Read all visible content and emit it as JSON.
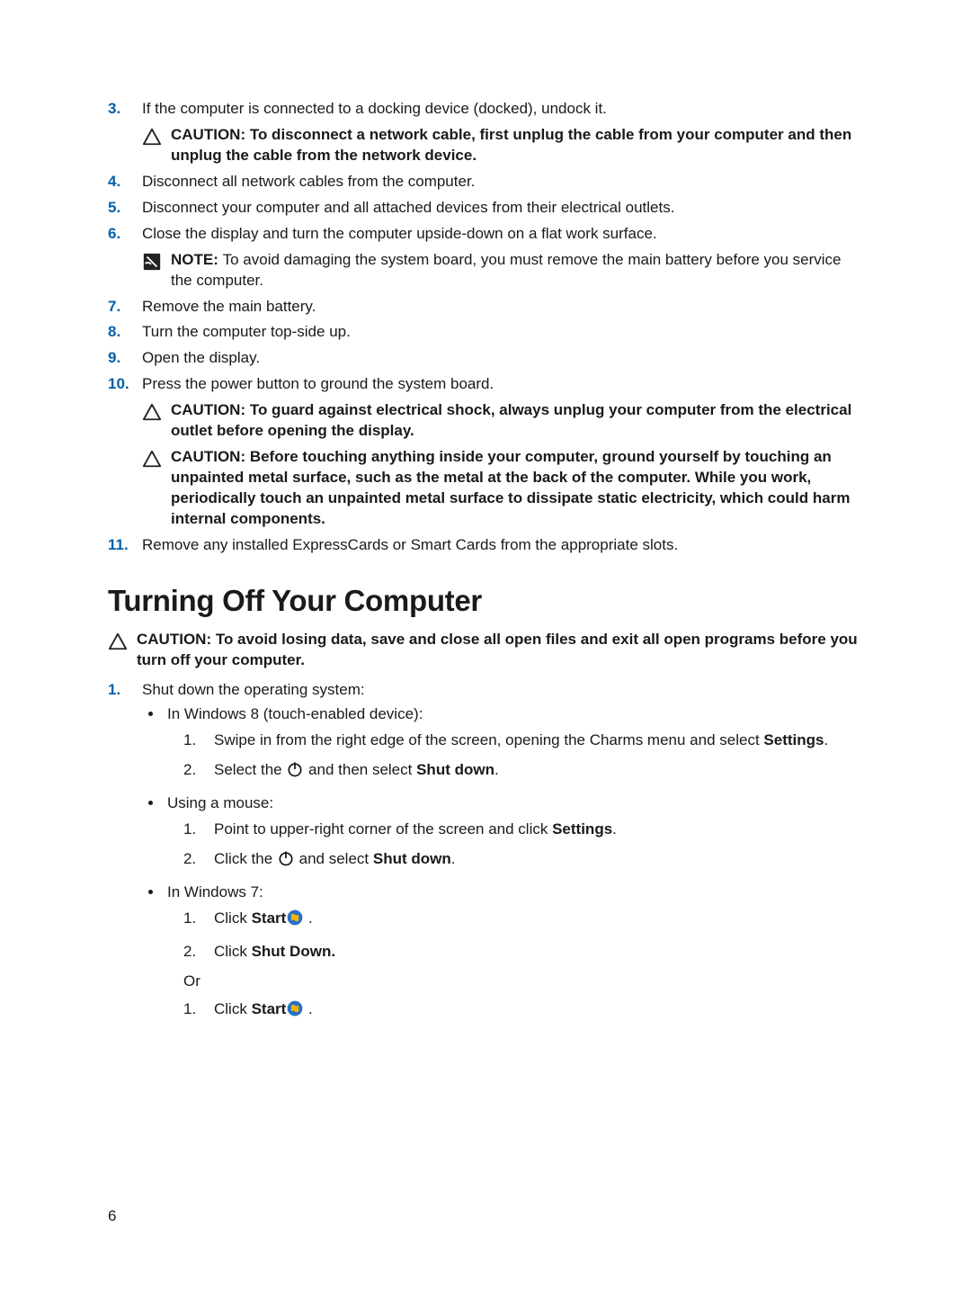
{
  "steps_a": [
    {
      "n": "3.",
      "text": "If the computer is connected to a docking device (docked), undock it."
    },
    {
      "n": "4.",
      "text": "Disconnect all network cables from the computer."
    },
    {
      "n": "5.",
      "text": "Disconnect your computer and all attached devices from their electrical outlets."
    },
    {
      "n": "6.",
      "text": "Close the display and turn the computer upside-down on a flat work surface."
    },
    {
      "n": "7.",
      "text": "Remove the main battery."
    },
    {
      "n": "8.",
      "text": "Turn the computer top-side up."
    },
    {
      "n": "9.",
      "text": "Open the display."
    },
    {
      "n": "10.",
      "text": "Press the power button to ground the system board."
    },
    {
      "n": "11.",
      "text": "Remove any installed ExpressCards or Smart Cards from the appropriate slots."
    }
  ],
  "caution1": {
    "label": "CAUTION: ",
    "text": "To disconnect a network cable, first unplug the cable from your computer and then unplug the cable from the network device."
  },
  "note1": {
    "label": "NOTE: ",
    "text": "To avoid damaging the system board, you must remove the main battery before you service the computer."
  },
  "caution2": {
    "label": "CAUTION: ",
    "text": "To guard against electrical shock, always unplug your computer from the electrical outlet before opening the display."
  },
  "caution3": {
    "label": "CAUTION: ",
    "text": "Before touching anything inside your computer, ground yourself by touching an unpainted metal surface, such as the metal at the back of the computer. While you work, periodically touch an unpainted metal surface to dissipate static electricity, which could harm internal components."
  },
  "section_title": "Turning Off Your Computer",
  "caution4": {
    "label": "CAUTION: ",
    "text": "To avoid losing data, save and close all open files and exit all open programs before you turn off your computer."
  },
  "turnoff": {
    "step1_n": "1.",
    "step1_text": "Shut down the operating system:",
    "win8_label": "In Windows 8 (touch-enabled device):",
    "win8_s1_n": "1.",
    "win8_s1_p1": "Swipe in from the right edge of the screen, opening the Charms menu and select ",
    "win8_s1_b": "Settings",
    "win8_s1_p2": ".",
    "win8_s2_n": "2.",
    "win8_s2_p1": "Select the ",
    "win8_s2_p2": " and then select ",
    "win8_s2_b": "Shut down",
    "win8_s2_p3": ".",
    "mouse_label": "Using a mouse:",
    "mouse_s1_n": "1.",
    "mouse_s1_p1": "Point to upper-right corner of the screen and click ",
    "mouse_s1_b": "Settings",
    "mouse_s1_p2": ".",
    "mouse_s2_n": "2.",
    "mouse_s2_p1": "Click the ",
    "mouse_s2_p2": " and select ",
    "mouse_s2_b": "Shut down",
    "mouse_s2_p3": ".",
    "win7_label": "In Windows 7:",
    "win7_s1_n": "1.",
    "win7_s1_p1": "Click ",
    "win7_s1_b": "Start",
    "win7_s1_p2": " .",
    "win7_s2_n": "2.",
    "win7_s2_p1": "Click ",
    "win7_s2_b": "Shut Down.",
    "or": "Or",
    "win7b_s1_n": "1.",
    "win7b_s1_p1": "Click ",
    "win7b_s1_b": "Start",
    "win7b_s1_p2": " ."
  },
  "page_number": "6"
}
